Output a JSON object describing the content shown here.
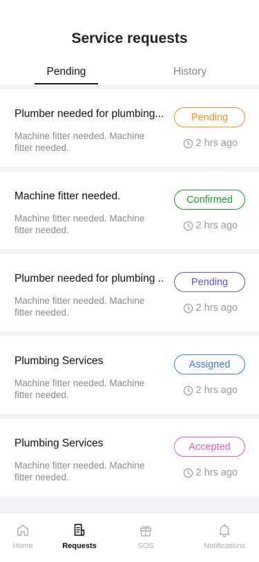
{
  "header": {
    "title": "Service requests",
    "tabs": [
      {
        "label": "Pending",
        "active": true
      },
      {
        "label": "History",
        "active": false
      }
    ]
  },
  "requests": [
    {
      "title": "Plumber needed for plumbing...",
      "description": "Machine fitter needed. Machine fitter needed.",
      "status": "Pending",
      "status_color": "#f7931e",
      "time": "2 hrs ago"
    },
    {
      "title": "Machine fitter needed.",
      "description": "Machine fitter needed. Machine fitter needed.",
      "status": "Confirmed",
      "status_color": "#1f9a2e",
      "time": "2 hrs ago"
    },
    {
      "title": "Plumber needed for plumbing ..",
      "description": "Machine fitter needed. Machine fitter needed.",
      "status": "Pending",
      "status_color": "#6a4fd8",
      "time": "2 hrs ago"
    },
    {
      "title": "Plumbing Services",
      "description": "Machine fitter needed. Machine fitter needed.",
      "status": "Assigned",
      "status_color": "#3a7ddc",
      "time": "2 hrs ago"
    },
    {
      "title": "Plumbing Services",
      "description": "Machine fitter needed. Machine fitter needed.",
      "status": "Accepted",
      "status_color": "#e05cc0",
      "time": "2 hrs ago"
    }
  ],
  "tabbar": {
    "items": [
      {
        "label": "Home",
        "icon": "home-icon",
        "active": false
      },
      {
        "label": "Requests",
        "icon": "document-icon",
        "active": true
      },
      {
        "label": "SOS",
        "icon": "gift-icon",
        "active": false
      },
      {
        "label": "Notifications",
        "icon": "bell-icon",
        "active": false
      }
    ]
  }
}
